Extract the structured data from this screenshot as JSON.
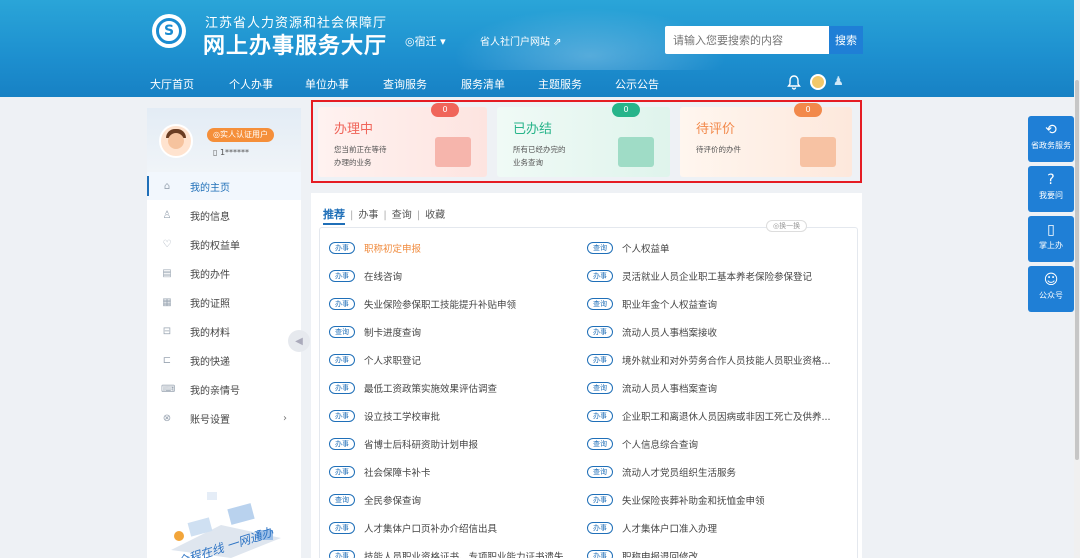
{
  "header": {
    "org_name": "江苏省人力资源和社会保障厅",
    "site_title": "网上办事服务大厅",
    "city": "◎宿迁 ▾",
    "portal_link": "省人社门户网站 ⇗",
    "search_placeholder": "请输入您要搜索的内容",
    "search_button": "搜索"
  },
  "nav": [
    "大厅首页",
    "个人办事",
    "单位办事",
    "查询服务",
    "服务清单",
    "主题服务",
    "公示公告"
  ],
  "profile": {
    "badge": "◎实人认证用户",
    "uid": "▯ 1******"
  },
  "sidebar": {
    "items": [
      {
        "icon": "home-icon",
        "glyph": "⌂",
        "label": "我的主页"
      },
      {
        "icon": "user-icon",
        "glyph": "♙",
        "label": "我的信息"
      },
      {
        "icon": "shield-icon",
        "glyph": "♡",
        "label": "我的权益单"
      },
      {
        "icon": "file-icon",
        "glyph": "▤",
        "label": "我的办件"
      },
      {
        "icon": "certificate-icon",
        "glyph": "▦",
        "label": "我的证照"
      },
      {
        "icon": "folder-icon",
        "glyph": "⊟",
        "label": "我的材料"
      },
      {
        "icon": "delivery-icon",
        "glyph": "⊏",
        "label": "我的快递"
      },
      {
        "icon": "message-icon",
        "glyph": "⌨",
        "label": "我的亲情号"
      },
      {
        "icon": "settings-icon",
        "glyph": "⊗",
        "label": "账号设置"
      }
    ],
    "arrow": "›",
    "collapse": "◀"
  },
  "status_cards": [
    {
      "title": "办理中",
      "desc_line1": "您当前正在等待",
      "desc_line2": "办理的业务",
      "count": "0",
      "color": "#f0655a",
      "badge": "#f0655a"
    },
    {
      "title": "已办结",
      "desc_line1": "所有已经办完的",
      "desc_line2": "业务查询",
      "count": "0",
      "color": "#27b48a",
      "badge": "#27b48a"
    },
    {
      "title": "待评价",
      "desc_line1": "待评价的办件",
      "desc_line2": "",
      "count": "0",
      "color": "#f2894b",
      "badge": "#f2894b"
    }
  ],
  "tabs": {
    "items": [
      "推荐",
      "办事",
      "查询",
      "收藏"
    ],
    "sep": "|"
  },
  "refresh": "◎换一换",
  "services_left": [
    {
      "tag": "办事",
      "label": "职称初定申报",
      "highlight": true
    },
    {
      "tag": "办事",
      "label": "在线咨询",
      "highlight": false
    },
    {
      "tag": "办事",
      "label": "失业保险参保职工技能提升补贴申领",
      "highlight": false
    },
    {
      "tag": "查询",
      "label": "制卡进度查询",
      "highlight": false
    },
    {
      "tag": "办事",
      "label": "个人求职登记",
      "highlight": false
    },
    {
      "tag": "办事",
      "label": "最低工资政策实施效果评估调查",
      "highlight": false
    },
    {
      "tag": "办事",
      "label": "设立技工学校审批",
      "highlight": false
    },
    {
      "tag": "办事",
      "label": "省博士后科研资助计划申报",
      "highlight": false
    },
    {
      "tag": "办事",
      "label": "社会保障卡补卡",
      "highlight": false
    },
    {
      "tag": "查询",
      "label": "全民参保查询",
      "highlight": false
    },
    {
      "tag": "办事",
      "label": "人才集体户口页补办介绍信出具",
      "highlight": false
    },
    {
      "tag": "办事",
      "label": "技能人员职业资格证书、专项职业能力证书遗失...",
      "highlight": false
    }
  ],
  "services_right": [
    {
      "tag": "查询",
      "label": "个人权益单"
    },
    {
      "tag": "办事",
      "label": "灵活就业人员企业职工基本养老保险参保登记"
    },
    {
      "tag": "查询",
      "label": "职业年金个人权益查询"
    },
    {
      "tag": "办事",
      "label": "流动人员人事档案接收"
    },
    {
      "tag": "办事",
      "label": "境外就业和对外劳务合作人员技能人员职业资格..."
    },
    {
      "tag": "查询",
      "label": "流动人员人事档案查询"
    },
    {
      "tag": "办事",
      "label": "企业职工和离退休人员因病或非因工死亡及供养..."
    },
    {
      "tag": "查询",
      "label": "个人信息综合查询"
    },
    {
      "tag": "查询",
      "label": "流动人才党员组织生活服务"
    },
    {
      "tag": "办事",
      "label": "失业保险丧葬补助金和抚恤金申领"
    },
    {
      "tag": "办事",
      "label": "人才集体户口准入办理"
    },
    {
      "tag": "办事",
      "label": "职称申报退回修改"
    }
  ],
  "float_buttons": [
    {
      "icon": "gov-service-icon",
      "glyph": "⟲",
      "label": "省政务服务"
    },
    {
      "icon": "question-icon",
      "glyph": "?",
      "label": "我要问"
    },
    {
      "icon": "mobile-icon",
      "glyph": "▯",
      "label": "掌上办"
    },
    {
      "icon": "wechat-icon",
      "glyph": "☺",
      "label": "公众号"
    }
  ],
  "colors": {
    "header": "#1d8fcf",
    "accent": "#1f6fb8",
    "highlight_frame": "#e51c23",
    "float": "#1f7fd6"
  }
}
